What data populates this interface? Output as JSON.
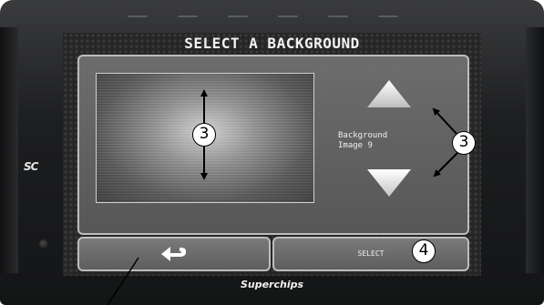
{
  "screen": {
    "title": "SELECT A BACKGROUND",
    "background_label_line1": "Background",
    "background_label_line2": "Image 9"
  },
  "buttons": {
    "back_icon": "back-arrow-icon",
    "select_label": "SELECT",
    "up_icon": "triangle-up-icon",
    "down_icon": "triangle-down-icon"
  },
  "device": {
    "logo_text": "SC",
    "brand_text": "Superchips"
  },
  "callouts": {
    "preview": "3",
    "arrows": "3",
    "select": "4"
  },
  "colors": {
    "screen_bg": "#262626",
    "panel_bg": "#666666",
    "panel_border": "#bdbdbd",
    "device_body": "#1d1e20"
  }
}
